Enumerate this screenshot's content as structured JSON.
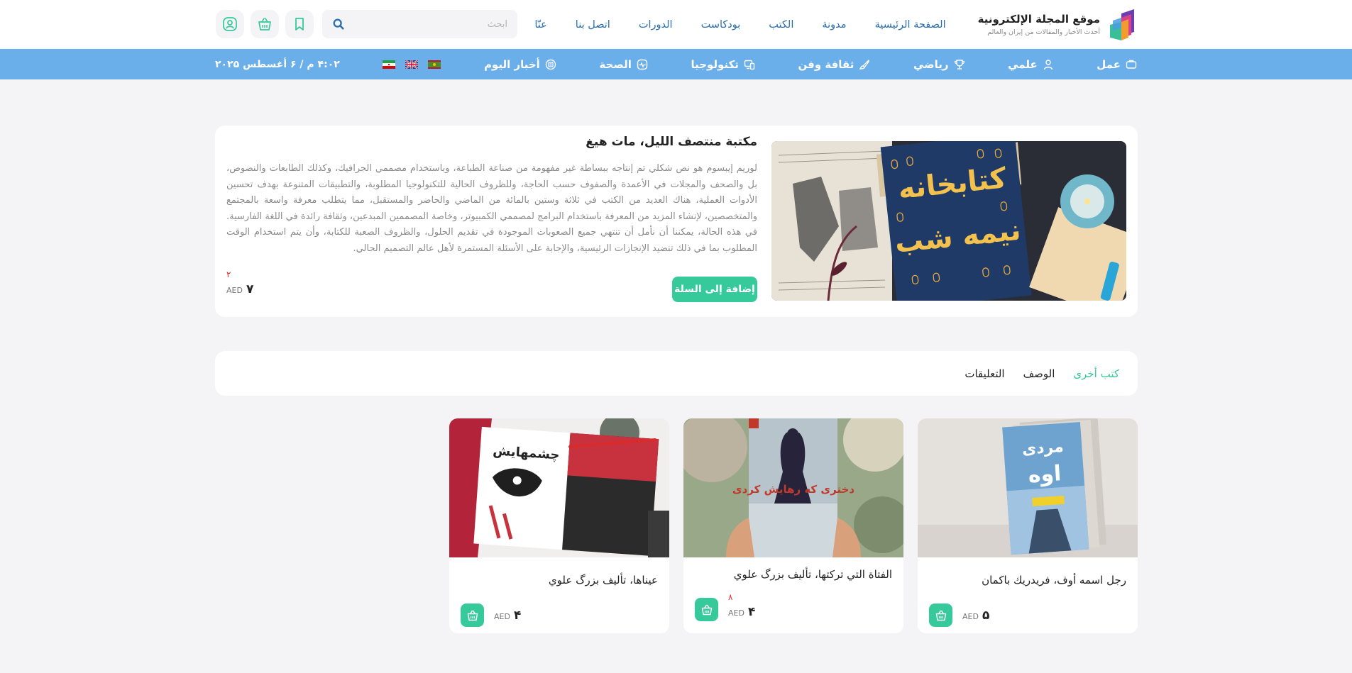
{
  "brand": {
    "title": "موقع المجلة الإلكترونية",
    "subtitle": "أحدث الأخبار والمقالات من إيران والعالم"
  },
  "nav": [
    "الصفحة الرئيسية",
    "مدونة",
    "الكتب",
    "بودكاست",
    "الدورات",
    "اتصل بنا",
    "عنّا"
  ],
  "search": {
    "placeholder": "ابحث"
  },
  "categories": [
    {
      "label": "عمل",
      "icon": "briefcase-icon"
    },
    {
      "label": "علمي",
      "icon": "person-icon"
    },
    {
      "label": "رياضي",
      "icon": "trophy-icon"
    },
    {
      "label": "ثقافة وفن",
      "icon": "brush-icon"
    },
    {
      "label": "تكنولوجيا",
      "icon": "devices-icon"
    },
    {
      "label": "الصحة",
      "icon": "heartbeat-icon"
    },
    {
      "label": "أخبار اليوم",
      "icon": "news-icon"
    }
  ],
  "date": "۴:۰۲ م / ۶ أغسطس ۲۰۲۵",
  "featured": {
    "title": "مكتبة منتصف الليل، مات هيغ",
    "description": "لوريم إيبسوم هو نص شكلي تم إنتاجه ببساطة غير مفهومة من صناعة الطباعة، وباستخدام مصممي الجرافيك، وكذلك الطابعات والنصوص، بل والصحف والمجلات في الأعمدة والصفوف حسب الحاجة، وللظروف الحالية للتكنولوجيا المطلوبة، والتطبيقات المتنوعة بهدف تحسين الأدوات العملية، هناك العديد من الكتب في ثلاثة وستين بالمائة من الماضي والحاضر والمستقبل، مما يتطلب معرفة واسعة بالمجتمع والمتخصصين، لإنشاء المزيد من المعرفة باستخدام البرامج لمصممي الكمبيوتر، وخاصة المصممين المبدعين، وثقافة رائدة في اللغة الفارسية. في هذه الحالة، يمكننا أن نأمل أن تنتهي جميع الصعوبات الموجودة في تقديم الحلول، والظروف الصعبة للكتابة، وأن يتم استخدام الوقت المطلوب بما في ذلك تنضيد الإنجازات الرئيسية، والإجابة على الأسئلة المستمرة لأهل عالم التصميم الحالي.",
    "add_to_cart": "إضافة إلى السلة",
    "old_price": "۲",
    "price": "۷",
    "currency": "AED"
  },
  "tabs": [
    "كتب أخرى",
    "الوصف",
    "التعليقات"
  ],
  "products": [
    {
      "title": "رجل اسمه أوف، فريدريك باكمان",
      "price": "۵",
      "currency": "AED",
      "old_price": ""
    },
    {
      "title": "الفتاة التي تركتها، تأليف بزرگ علوي",
      "price": "۴",
      "currency": "AED",
      "old_price": "۸"
    },
    {
      "title": "عيناها، تأليف بزرگ علوي",
      "price": "۴",
      "currency": "AED",
      "old_price": ""
    }
  ],
  "colors": {
    "accent": "#36c99a",
    "nav_blue": "#2b6fb0",
    "category_bar": "#6aaeea",
    "old_price": "#e03030"
  }
}
